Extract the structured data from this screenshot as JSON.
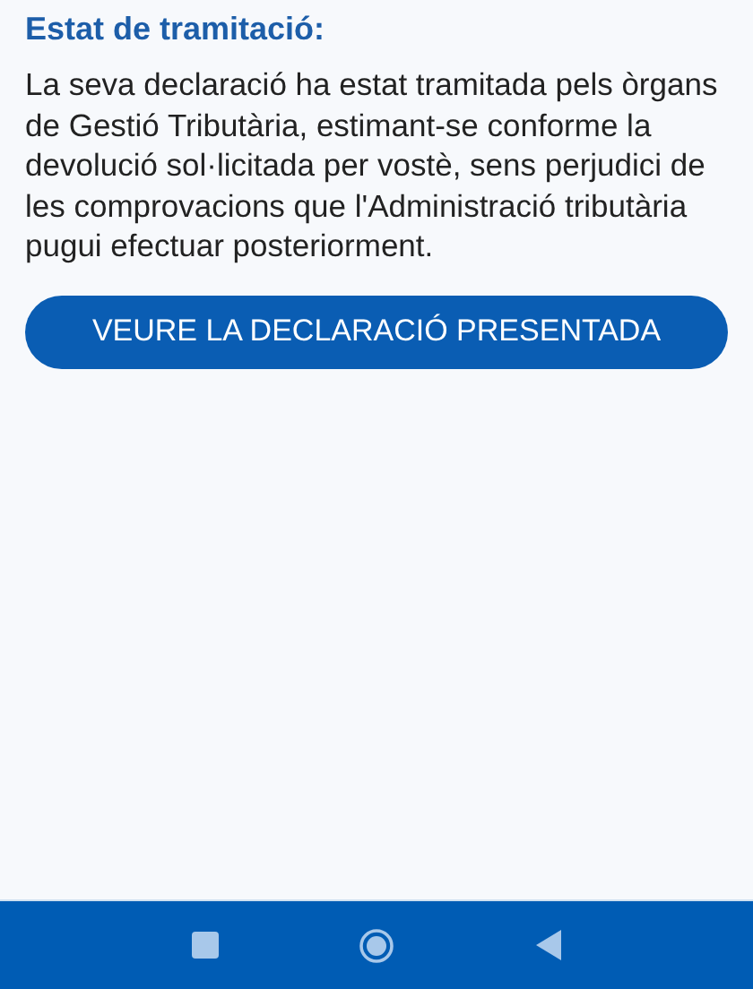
{
  "status": {
    "title": "Estat de tramitació:",
    "message": "La seva declaració ha estat tramitada pels òrgans de Gestió Tributària, estimant-se conforme la devolució sol·licitada per vostè, sens perjudici de les comprovacions que l'Administració tributària pugui efectuar posteriorment.",
    "button": "VEURE LA DECLARACIÓ PRESENTADA"
  },
  "nav_bar": {
    "buttons": [
      {
        "kind": "recents"
      },
      {
        "kind": "home"
      },
      {
        "kind": "back"
      }
    ]
  }
}
